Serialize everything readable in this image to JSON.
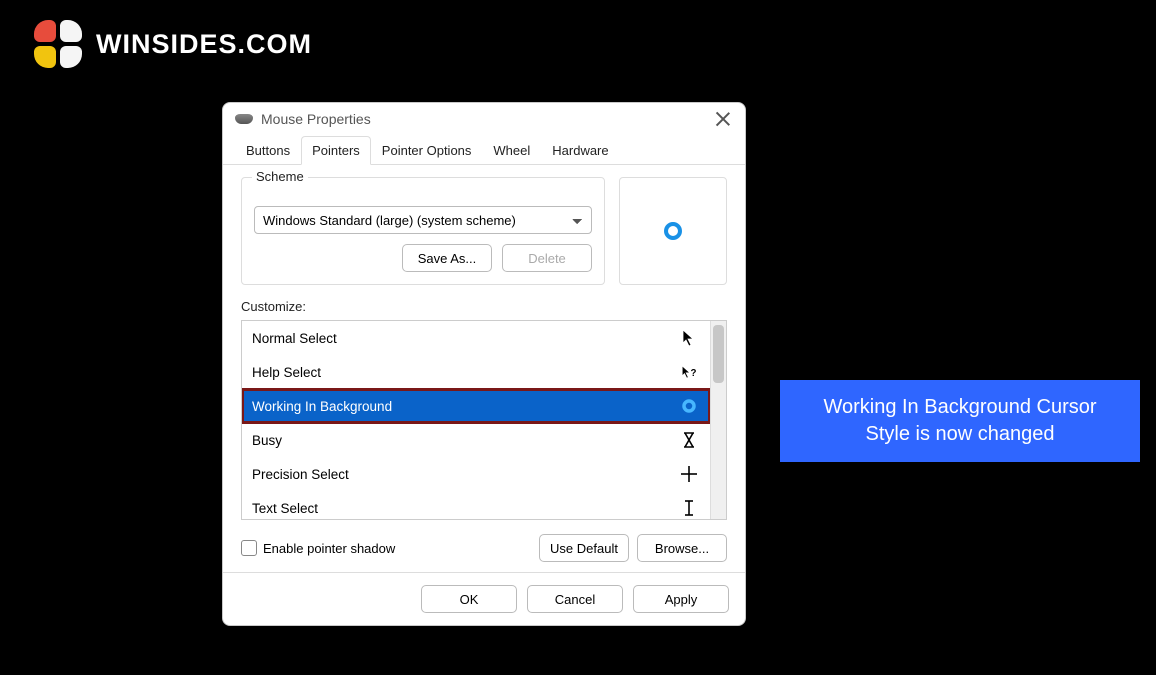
{
  "brand": {
    "name": "WINSIDES.COM"
  },
  "callout": {
    "line1": "Working In Background Cursor",
    "line2": "Style is now changed"
  },
  "dialog": {
    "title": "Mouse Properties",
    "tabs": [
      "Buttons",
      "Pointers",
      "Pointer Options",
      "Wheel",
      "Hardware"
    ],
    "active_tab_index": 1,
    "scheme": {
      "legend": "Scheme",
      "selected": "Windows Standard (large) (system scheme)",
      "save_as_label": "Save As...",
      "delete_label": "Delete"
    },
    "customize_label": "Customize:",
    "cursors": [
      {
        "label": "Normal Select",
        "icon": "arrow",
        "selected": false
      },
      {
        "label": "Help Select",
        "icon": "arrow-q",
        "selected": false
      },
      {
        "label": "Working In Background",
        "icon": "ring",
        "selected": true,
        "highlighted": true
      },
      {
        "label": "Busy",
        "icon": "hourglass",
        "selected": false
      },
      {
        "label": "Precision Select",
        "icon": "cross",
        "selected": false
      },
      {
        "label": "Text Select",
        "icon": "ibeam",
        "selected": false
      }
    ],
    "enable_shadow_label": "Enable pointer shadow",
    "enable_shadow_checked": false,
    "use_default_label": "Use Default",
    "browse_label": "Browse...",
    "footer": {
      "ok": "OK",
      "cancel": "Cancel",
      "apply": "Apply"
    }
  }
}
